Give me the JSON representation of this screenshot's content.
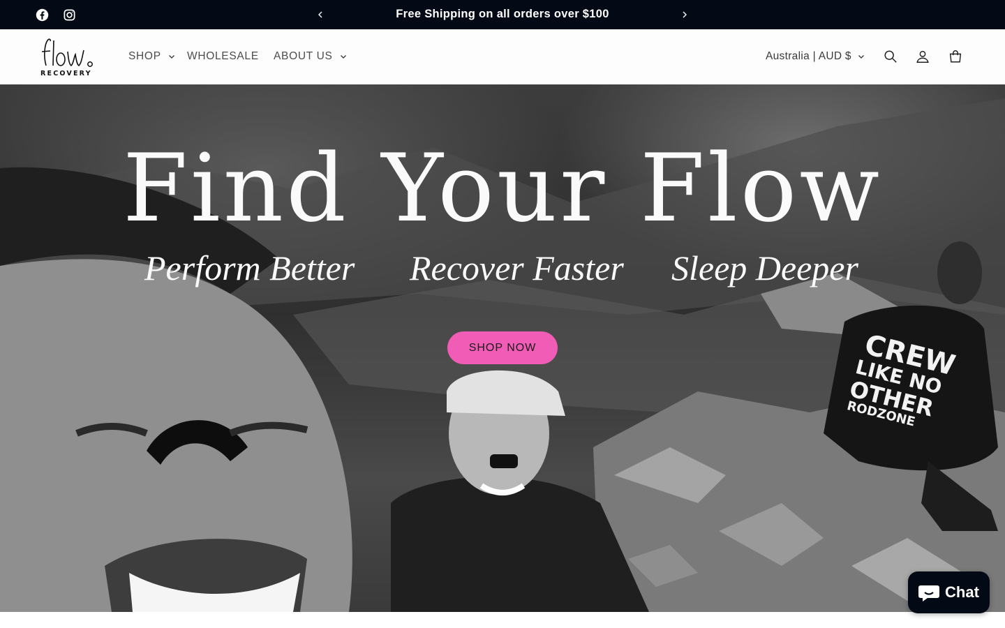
{
  "announcement": {
    "text": "Free Shipping on all orders over $100",
    "social": [
      "facebook-icon",
      "instagram-icon"
    ],
    "colors": {
      "background": "#030a16",
      "text": "#ffffff"
    }
  },
  "header": {
    "logo": {
      "wordmark": "flow",
      "subtext": "RECOVERY"
    },
    "nav": [
      {
        "label": "SHOP",
        "has_dropdown": true
      },
      {
        "label": "WHOLESALE",
        "has_dropdown": false
      },
      {
        "label": "ABOUT US",
        "has_dropdown": true
      }
    ],
    "locale": "Australia | AUD $",
    "icons": [
      "search-icon",
      "account-icon",
      "cart-icon"
    ]
  },
  "hero": {
    "title": "Find Your Flow",
    "taglines": [
      "Perform Better",
      "Recover Faster",
      "Sleep Deeper"
    ],
    "cta": "SHOP NOW",
    "shirt_text": [
      "CREW",
      "LIKE NO",
      "OTHER",
      "RODZONE"
    ],
    "colors": {
      "cta_background": "#f15cb7",
      "text": "#fafafa"
    }
  },
  "chat": {
    "label": "Chat"
  }
}
